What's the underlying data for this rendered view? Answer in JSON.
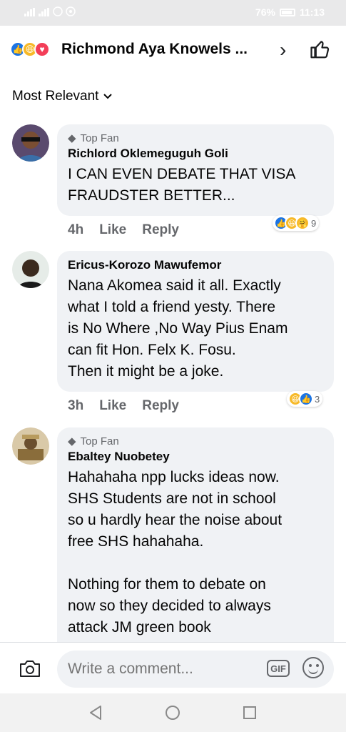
{
  "status_bar": {
    "battery": "76%",
    "time": "11:13"
  },
  "header": {
    "title": "Richmond Aya Knowels ...",
    "reaction_icons": [
      "like",
      "haha",
      "love"
    ]
  },
  "sort": {
    "label": "Most Relevant"
  },
  "comments": [
    {
      "badge": "Top Fan",
      "author": "Richlord Oklemeguguh Goli",
      "text": "I CAN EVEN DEBATE THAT VISA\nFRAUDSTER BETTER...",
      "time": "4h",
      "like": "Like",
      "reply": "Reply",
      "reactions": [
        "like",
        "haha",
        "care"
      ],
      "reaction_count": "9"
    },
    {
      "badge": "",
      "author": "Ericus-Korozo Mawufemor",
      "text": "Nana Akomea said it all. Exactly\nwhat I told a friend yesty. There\nis No Where ,No Way Pius Enam\ncan fit Hon. Felx K. Fosu.\nThen it might be a joke.",
      "time": "3h",
      "like": "Like",
      "reply": "Reply",
      "reactions": [
        "haha",
        "like"
      ],
      "reaction_count": "3"
    },
    {
      "badge": "Top Fan",
      "author": "Ebaltey Nuobetey",
      "text": "Hahahaha npp lucks ideas now.\nSHS Students are not in school\nso u hardly hear the noise about\nfree SHS hahahaha.\n\nNothing for them to debate on\nnow so they decided to always\nattack JM green book"
    }
  ],
  "composer": {
    "placeholder": "Write a comment...",
    "gif_label": "GIF"
  },
  "colors": {
    "accent": "#1b74e4",
    "bubble": "#f0f2f5",
    "muted": "#65676b"
  }
}
